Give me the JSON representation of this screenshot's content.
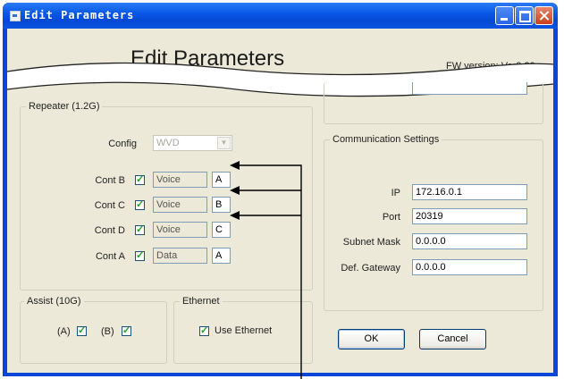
{
  "window": {
    "title": "Edit Parameters",
    "buttons": [
      "minimize",
      "maximize",
      "close"
    ]
  },
  "header": {
    "title": "Edit Parameters",
    "fw_version": "FW version: Ver2.20"
  },
  "repeater": {
    "legend": "Repeater (1.2G)",
    "config_label": "Config",
    "config_value": "WVD",
    "rows": [
      {
        "label": "Cont B",
        "checked": true,
        "type": "Voice",
        "id": "A"
      },
      {
        "label": "Cont C",
        "checked": true,
        "type": "Voice",
        "id": "B"
      },
      {
        "label": "Cont D",
        "checked": true,
        "type": "Voice",
        "id": "C"
      },
      {
        "label": "Cont A",
        "checked": true,
        "type": "Data",
        "id": "A"
      }
    ]
  },
  "assist": {
    "legend": "Assist (10G)",
    "a_label": "(A)",
    "b_label": "(B)",
    "a_checked": true,
    "b_checked": true
  },
  "ethernet": {
    "legend": "Ethernet",
    "use_label": "Use Ethernet",
    "checked": true
  },
  "comm": {
    "legend": "Communication Settings",
    "ip_label": "IP",
    "ip_value": "172.16.0.1",
    "port_label": "Port",
    "port_value": "20319",
    "subnet_label": "Subnet Mask",
    "subnet_value": "0.0.0.0",
    "gateway_label": "Def. Gateway",
    "gateway_value": "0.0.0.0"
  },
  "actions": {
    "ok_label": "OK",
    "cancel_label": "Cancel"
  },
  "colors": {
    "titlebar": "#0548d6",
    "window_bg": "#ece9d8",
    "check": "#21a121"
  }
}
